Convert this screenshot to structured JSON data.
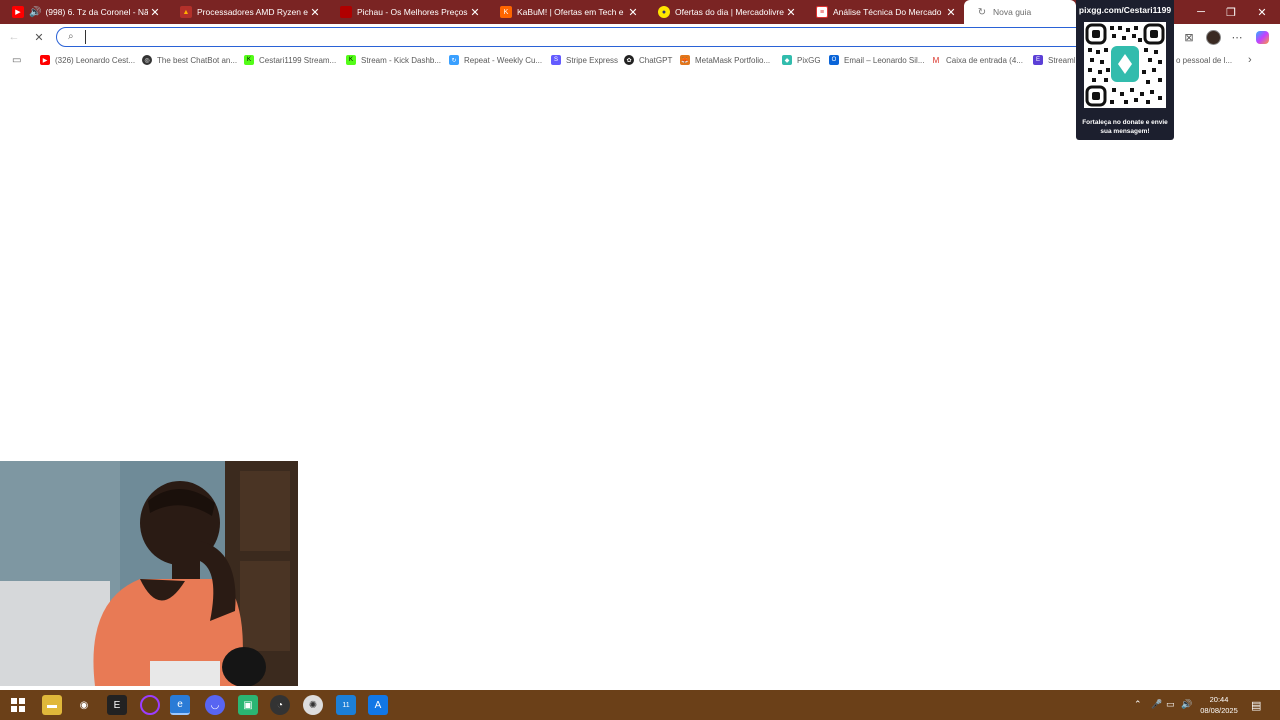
{
  "tabs": [
    {
      "title": "(998) 6. Tz da Coronel - Não",
      "favicon": "youtube-icon",
      "color": "#ff0000",
      "active": false
    },
    {
      "title": "Processadores AMD Ryzen e Athl",
      "favicon": "amd-icon",
      "color": "#e0a000",
      "active": false
    },
    {
      "title": "Pichau - Os Melhores Preços do P",
      "favicon": "pichau-icon",
      "color": "#d40000",
      "active": false
    },
    {
      "title": "KaBuM! | Ofertas em Tech e Gam",
      "favicon": "kabum-icon",
      "color": "#ff6500",
      "active": false
    },
    {
      "title": "Ofertas do dia | Mercadolivre Bra",
      "favicon": "mercadolivre-icon",
      "color": "#ffe600",
      "active": false
    },
    {
      "title": "Análise Técnica Do Mercado Fina",
      "favicon": "document-icon",
      "color": "#e33",
      "active": false
    },
    {
      "title": "Nova guia",
      "favicon": "loading-icon",
      "color": "#888888",
      "active": true
    }
  ],
  "toolbar": {
    "omnibox_placeholder": ""
  },
  "bookmarks": [
    {
      "label": "(326) Leonardo Cest...",
      "icon": "youtube-icon",
      "color": "#ff0000"
    },
    {
      "label": "The best ChatBot an...",
      "icon": "chatbot-icon",
      "color": "#333333"
    },
    {
      "label": "Cestari1199 Stream...",
      "icon": "kick-icon",
      "color": "#53fc18"
    },
    {
      "label": "Stream - Kick Dashb...",
      "icon": "kick-icon",
      "color": "#53fc18"
    },
    {
      "label": "Repeat - Weekly Cu...",
      "icon": "repeat-icon",
      "color": "#3aa0ff"
    },
    {
      "label": "Stripe Express",
      "icon": "stripe-icon",
      "color": "#635bff"
    },
    {
      "label": "ChatGPT",
      "icon": "chatgpt-icon",
      "color": "#222222"
    },
    {
      "label": "MetaMask Portfolio...",
      "icon": "metamask-icon",
      "color": "#e2761b"
    },
    {
      "label": "PixGG",
      "icon": "pixgg-icon",
      "color": "#32bcad"
    },
    {
      "label": "Email – Leonardo Sil...",
      "icon": "outlook-icon",
      "color": "#0a64d8"
    },
    {
      "label": "Caixa de entrada (4...",
      "icon": "gmail-icon",
      "color": "#d93025"
    },
    {
      "label": "StreamE",
      "icon": "streamelements-icon",
      "color": "#5b3fd6"
    }
  ],
  "bookmark_tail": "o pessoal de l...",
  "qr": {
    "url": "pixgg.com/Cestari1199",
    "caption": "Fortaleça no donate e envie sua mensagem!"
  },
  "taskbar": {
    "time": "20:44",
    "date": "08/08/2025",
    "badge": "11"
  },
  "colors": {
    "tabstrip": "#7a2423",
    "taskbar": "#6b4018",
    "omnibox_border": "#2a62d6",
    "qr_bg": "#1c1f2e"
  }
}
